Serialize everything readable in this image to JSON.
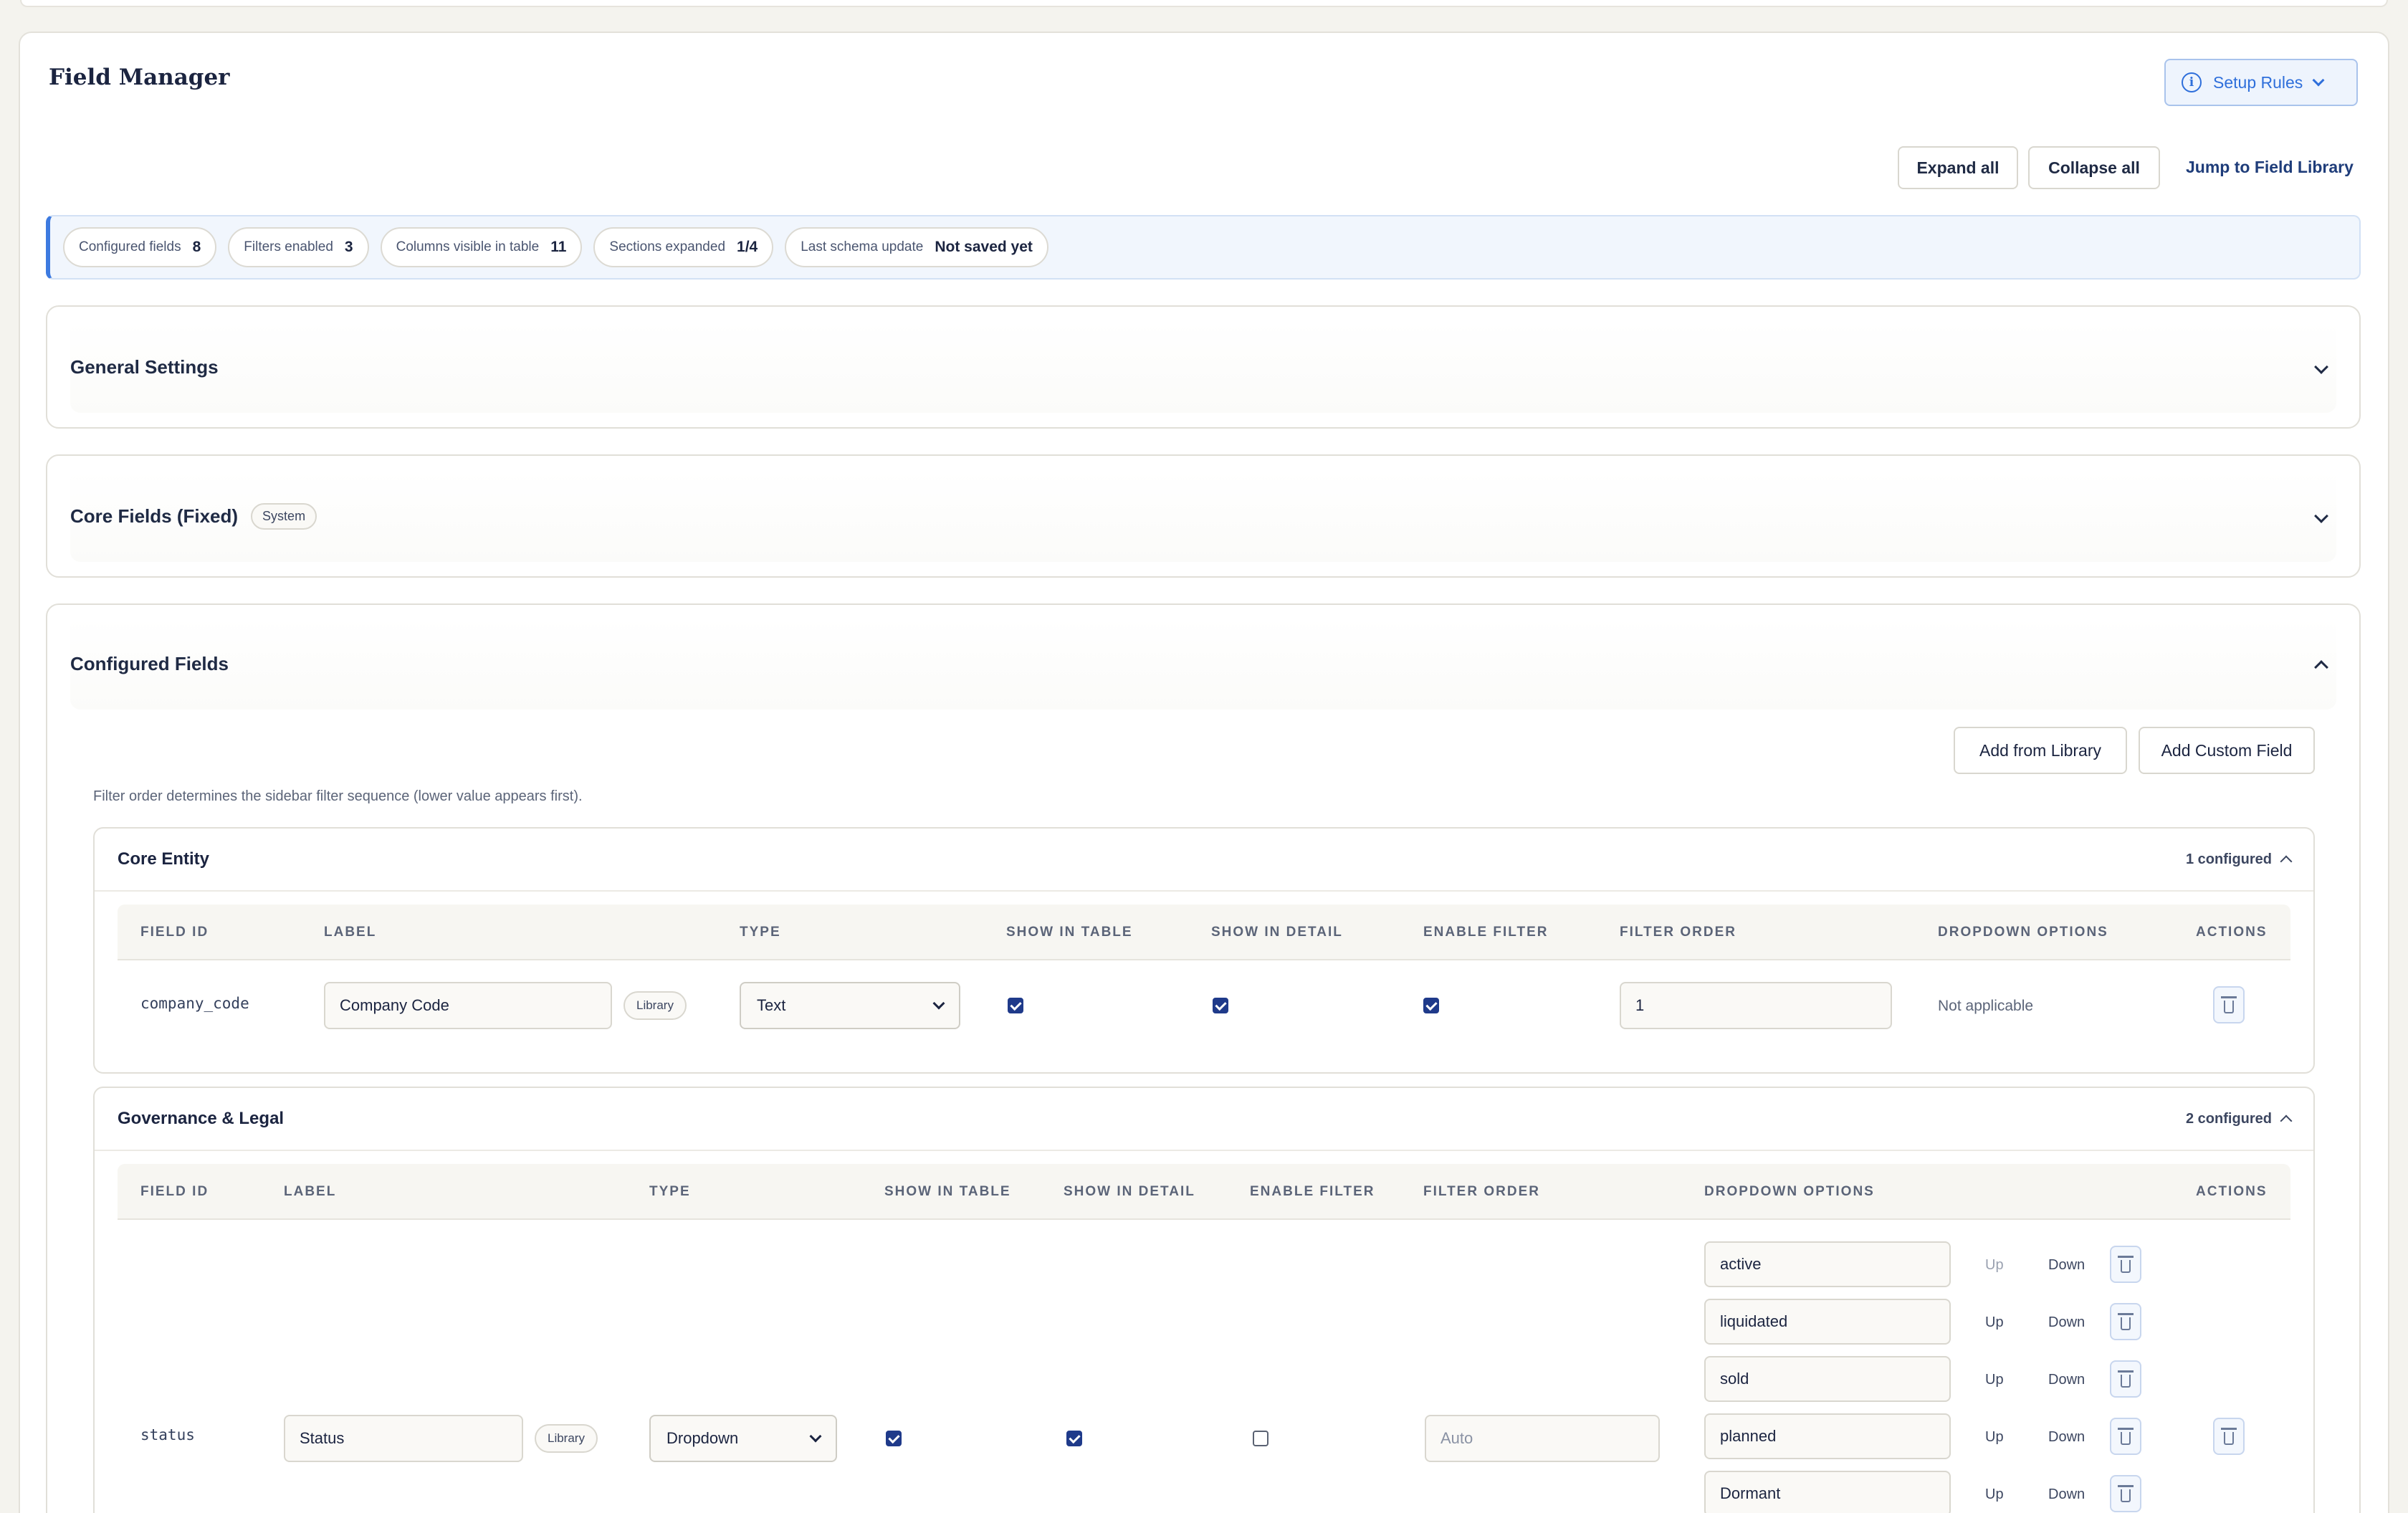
{
  "header": {
    "title": "Field Manager",
    "setup_rules_label": "Setup Rules"
  },
  "toolbar": {
    "expand_all": "Expand all",
    "collapse_all": "Collapse all",
    "jump_library": "Jump to Field Library"
  },
  "stats": [
    {
      "label": "Configured fields",
      "value": "8"
    },
    {
      "label": "Filters enabled",
      "value": "3"
    },
    {
      "label": "Columns visible in table",
      "value": "11"
    },
    {
      "label": "Sections expanded",
      "value": "1/4"
    },
    {
      "label": "Last schema update",
      "value": "Not saved yet"
    }
  ],
  "sections": {
    "general": {
      "title": "General Settings"
    },
    "core": {
      "title": "Core Fields (Fixed)",
      "badge": "System"
    },
    "configured": {
      "title": "Configured Fields",
      "add_library": "Add from Library",
      "add_custom": "Add Custom Field",
      "hint": "Filter order determines the sidebar filter sequence (lower value appears first)."
    }
  },
  "columns": {
    "field_id": "FIELD ID",
    "label": "LABEL",
    "type": "TYPE",
    "show_table": "SHOW IN TABLE",
    "show_detail": "SHOW IN DETAIL",
    "enable_filter": "ENABLE FILTER",
    "filter_order": "FILTER ORDER",
    "dropdown_options": "DROPDOWN OPTIONS",
    "actions": "ACTIONS"
  },
  "groups": {
    "core_entity": {
      "title": "Core Entity",
      "count": "1 configured",
      "row": {
        "field_id": "company_code",
        "label": "Company Code",
        "library_badge": "Library",
        "type": "Text",
        "show_table": true,
        "show_detail": true,
        "enable_filter": true,
        "filter_order": "1",
        "dropdown": "Not applicable"
      }
    },
    "governance": {
      "title": "Governance & Legal",
      "count": "2 configured",
      "row": {
        "field_id": "status",
        "label": "Status",
        "library_badge": "Library",
        "type": "Dropdown",
        "show_table": true,
        "show_detail": true,
        "enable_filter": false,
        "filter_order_placeholder": "Auto",
        "options": [
          "active",
          "liquidated",
          "sold",
          "planned",
          "Dormant"
        ],
        "up_label": "Up",
        "down_label": "Down"
      }
    }
  }
}
